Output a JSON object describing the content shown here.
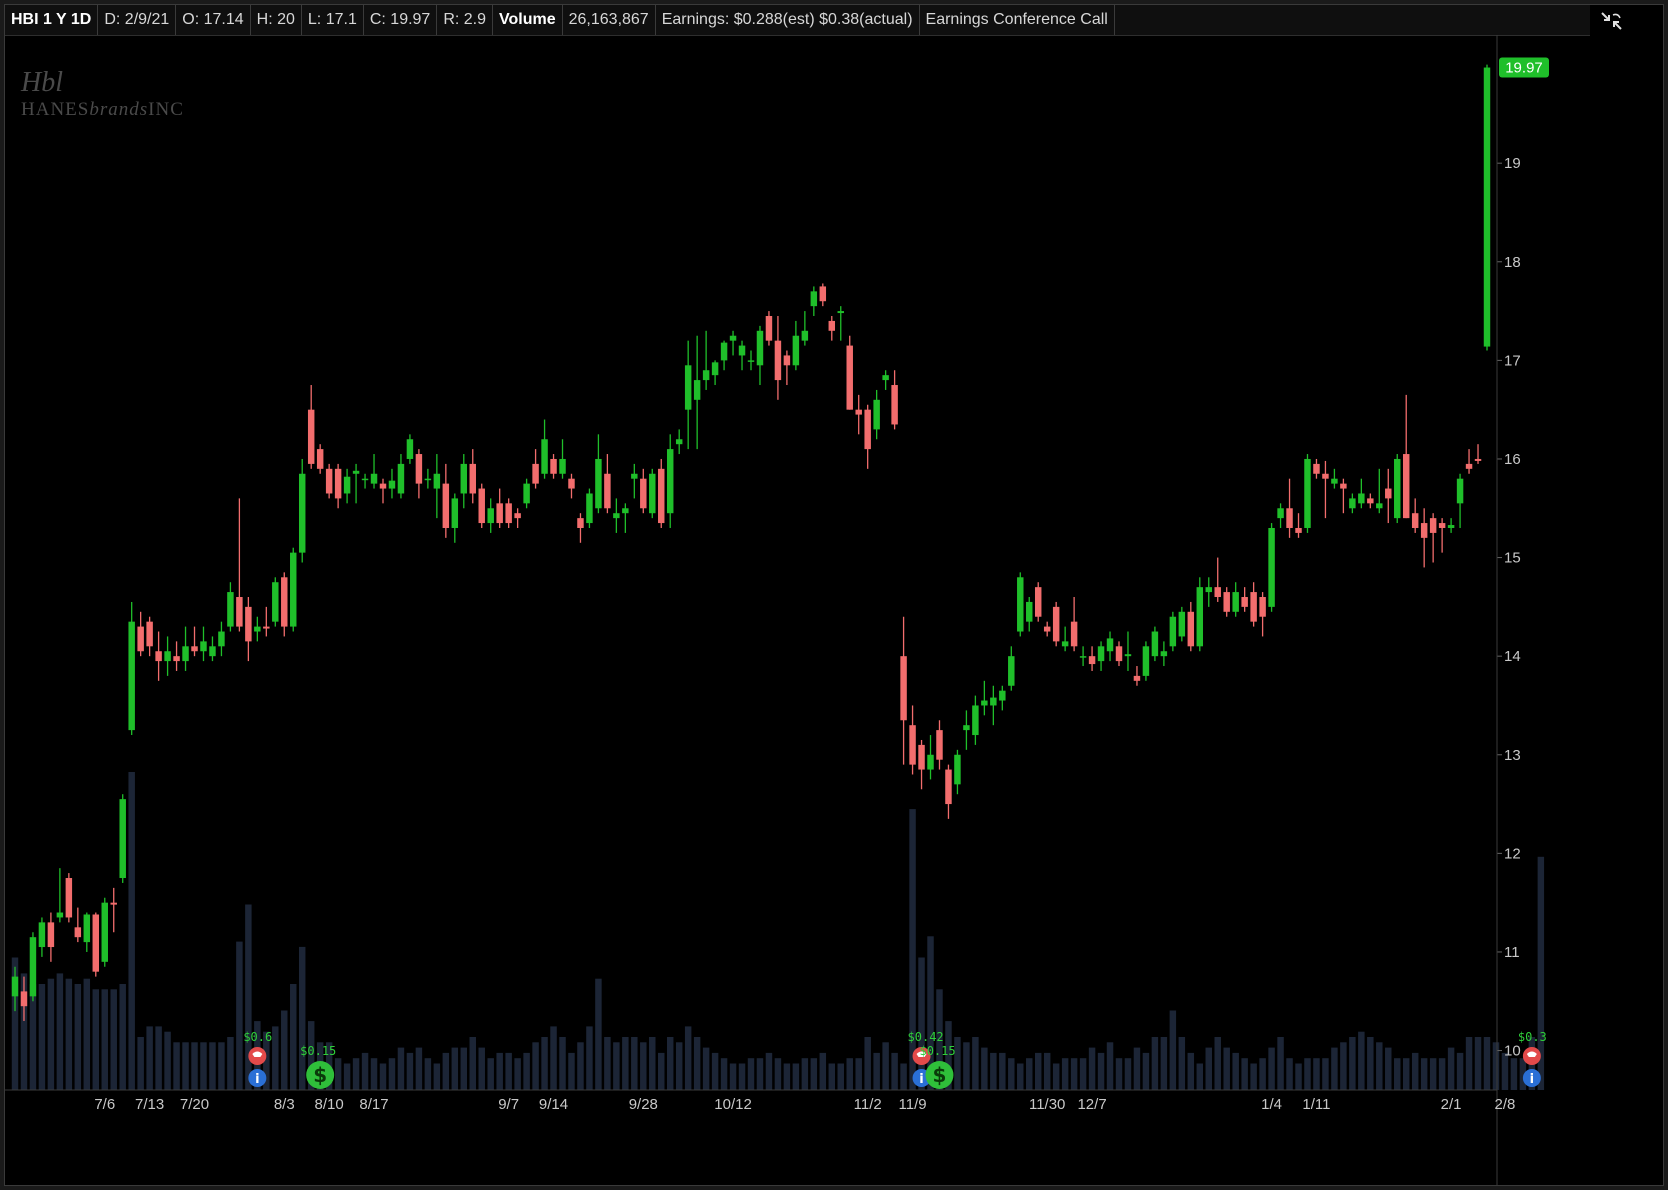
{
  "header": {
    "symbol": "HBI 1 Y 1D",
    "date": "D: 2/9/21",
    "open": "O: 17.14",
    "high": "H: 20",
    "low": "L: 17.1",
    "close": "C: 19.97",
    "range": "R: 2.9",
    "volume_label": "Volume",
    "volume_value": "26,163,867",
    "earnings": "Earnings: $0.288(est) $0.38(actual)",
    "event": "Earnings Conference Call"
  },
  "logo": {
    "mark": "Hbl",
    "wordmark": "HANESbrandsINC"
  },
  "icons": {
    "restore": "collapse-restore-icon",
    "earnings": "earnings-phone-icon",
    "dividend": "dividend-dollar-icon",
    "info": "info-icon"
  },
  "colors": {
    "up": "#1fbf2a",
    "down": "#f26d6d",
    "volume": "#1c2536",
    "background": "#000000",
    "last_price_bg": "#1fbf2a"
  },
  "chart_data": {
    "type": "candlestick",
    "symbol": "HBI",
    "period": "1 Y 1D",
    "ylim": [
      9.6,
      20.3
    ],
    "y_ticks": [
      10,
      11,
      12,
      13,
      14,
      15,
      16,
      17,
      18,
      19
    ],
    "x_ticks": [
      "7/6",
      "7/13",
      "7/20",
      "8/3",
      "8/10",
      "8/17",
      "9/7",
      "9/14",
      "9/28",
      "10/12",
      "11/2",
      "11/9",
      "11/30",
      "12/7",
      "1/4",
      "1/11",
      "2/1",
      "2/8"
    ],
    "last_price": "19.97",
    "candles": [
      {
        "o": 10.55,
        "h": 10.85,
        "l": 10.4,
        "c": 10.75
      },
      {
        "o": 10.6,
        "h": 10.75,
        "l": 10.3,
        "c": 10.45
      },
      {
        "o": 10.55,
        "h": 11.2,
        "l": 10.5,
        "c": 11.15
      },
      {
        "o": 11.05,
        "h": 11.35,
        "l": 10.95,
        "c": 11.3
      },
      {
        "o": 11.3,
        "h": 11.4,
        "l": 10.9,
        "c": 11.05
      },
      {
        "o": 11.35,
        "h": 11.85,
        "l": 11.3,
        "c": 11.4
      },
      {
        "o": 11.75,
        "h": 11.8,
        "l": 11.3,
        "c": 11.35
      },
      {
        "o": 11.25,
        "h": 11.45,
        "l": 11.1,
        "c": 11.15
      },
      {
        "o": 11.1,
        "h": 11.4,
        "l": 11.0,
        "c": 11.38
      },
      {
        "o": 11.38,
        "h": 11.4,
        "l": 10.75,
        "c": 10.8
      },
      {
        "o": 10.9,
        "h": 11.55,
        "l": 10.85,
        "c": 11.5
      },
      {
        "o": 11.5,
        "h": 11.65,
        "l": 11.2,
        "c": 11.48
      },
      {
        "o": 11.75,
        "h": 12.6,
        "l": 11.7,
        "c": 12.55
      },
      {
        "o": 13.25,
        "h": 14.55,
        "l": 13.2,
        "c": 14.35
      },
      {
        "o": 14.3,
        "h": 14.45,
        "l": 14.0,
        "c": 14.05
      },
      {
        "o": 14.35,
        "h": 14.4,
        "l": 14.0,
        "c": 14.1
      },
      {
        "o": 14.05,
        "h": 14.25,
        "l": 13.75,
        "c": 13.95
      },
      {
        "o": 13.95,
        "h": 14.2,
        "l": 13.8,
        "c": 14.05
      },
      {
        "o": 14.0,
        "h": 14.15,
        "l": 13.85,
        "c": 13.95
      },
      {
        "o": 13.95,
        "h": 14.3,
        "l": 13.85,
        "c": 14.1
      },
      {
        "o": 14.1,
        "h": 14.3,
        "l": 14.0,
        "c": 14.05
      },
      {
        "o": 14.05,
        "h": 14.3,
        "l": 13.95,
        "c": 14.15
      },
      {
        "o": 14.0,
        "h": 14.2,
        "l": 13.95,
        "c": 14.1
      },
      {
        "o": 14.1,
        "h": 14.35,
        "l": 14.0,
        "c": 14.25
      },
      {
        "o": 14.3,
        "h": 14.75,
        "l": 14.25,
        "c": 14.65
      },
      {
        "o": 14.6,
        "h": 15.6,
        "l": 14.25,
        "c": 14.3
      },
      {
        "o": 14.5,
        "h": 14.6,
        "l": 13.95,
        "c": 14.15
      },
      {
        "o": 14.25,
        "h": 14.4,
        "l": 14.15,
        "c": 14.3
      },
      {
        "o": 14.3,
        "h": 14.5,
        "l": 14.2,
        "c": 14.28
      },
      {
        "o": 14.35,
        "h": 14.8,
        "l": 14.3,
        "c": 14.75
      },
      {
        "o": 14.8,
        "h": 14.85,
        "l": 14.2,
        "c": 14.3
      },
      {
        "o": 14.3,
        "h": 15.1,
        "l": 14.25,
        "c": 15.05
      },
      {
        "o": 15.05,
        "h": 16.0,
        "l": 14.95,
        "c": 15.85
      },
      {
        "o": 16.5,
        "h": 16.75,
        "l": 15.9,
        "c": 15.95
      },
      {
        "o": 16.1,
        "h": 16.15,
        "l": 15.85,
        "c": 15.9
      },
      {
        "o": 15.9,
        "h": 15.95,
        "l": 15.6,
        "c": 15.65
      },
      {
        "o": 15.9,
        "h": 15.95,
        "l": 15.5,
        "c": 15.6
      },
      {
        "o": 15.65,
        "h": 15.9,
        "l": 15.55,
        "c": 15.82
      },
      {
        "o": 15.85,
        "h": 15.95,
        "l": 15.55,
        "c": 15.88
      },
      {
        "o": 15.8,
        "h": 15.85,
        "l": 15.7,
        "c": 15.8
      },
      {
        "o": 15.75,
        "h": 16.05,
        "l": 15.7,
        "c": 15.85
      },
      {
        "o": 15.75,
        "h": 15.8,
        "l": 15.55,
        "c": 15.7
      },
      {
        "o": 15.7,
        "h": 15.9,
        "l": 15.6,
        "c": 15.78
      },
      {
        "o": 15.65,
        "h": 16.05,
        "l": 15.6,
        "c": 15.95
      },
      {
        "o": 16.0,
        "h": 16.25,
        "l": 15.95,
        "c": 16.2
      },
      {
        "o": 16.05,
        "h": 16.1,
        "l": 15.6,
        "c": 15.75
      },
      {
        "o": 15.8,
        "h": 15.9,
        "l": 15.7,
        "c": 15.8
      },
      {
        "o": 15.7,
        "h": 16.05,
        "l": 15.4,
        "c": 15.85
      },
      {
        "o": 15.75,
        "h": 15.95,
        "l": 15.2,
        "c": 15.3
      },
      {
        "o": 15.3,
        "h": 15.65,
        "l": 15.15,
        "c": 15.6
      },
      {
        "o": 15.65,
        "h": 16.05,
        "l": 15.5,
        "c": 15.95
      },
      {
        "o": 15.95,
        "h": 16.1,
        "l": 15.55,
        "c": 15.65
      },
      {
        "o": 15.7,
        "h": 15.75,
        "l": 15.3,
        "c": 15.35
      },
      {
        "o": 15.35,
        "h": 15.6,
        "l": 15.25,
        "c": 15.5
      },
      {
        "o": 15.55,
        "h": 15.7,
        "l": 15.3,
        "c": 15.35
      },
      {
        "o": 15.55,
        "h": 15.6,
        "l": 15.3,
        "c": 15.35
      },
      {
        "o": 15.45,
        "h": 15.5,
        "l": 15.3,
        "c": 15.4
      },
      {
        "o": 15.55,
        "h": 15.8,
        "l": 15.5,
        "c": 15.75
      },
      {
        "o": 15.95,
        "h": 16.1,
        "l": 15.7,
        "c": 15.75
      },
      {
        "o": 15.85,
        "h": 16.4,
        "l": 15.8,
        "c": 16.2
      },
      {
        "o": 16.0,
        "h": 16.05,
        "l": 15.8,
        "c": 15.85
      },
      {
        "o": 15.85,
        "h": 16.2,
        "l": 15.8,
        "c": 16.0
      },
      {
        "o": 15.8,
        "h": 15.85,
        "l": 15.6,
        "c": 15.7
      },
      {
        "o": 15.4,
        "h": 15.45,
        "l": 15.15,
        "c": 15.3
      },
      {
        "o": 15.35,
        "h": 15.7,
        "l": 15.3,
        "c": 15.65
      },
      {
        "o": 15.5,
        "h": 16.25,
        "l": 15.45,
        "c": 16.0
      },
      {
        "o": 15.85,
        "h": 16.05,
        "l": 15.45,
        "c": 15.5
      },
      {
        "o": 15.4,
        "h": 15.6,
        "l": 15.25,
        "c": 15.45
      },
      {
        "o": 15.45,
        "h": 15.55,
        "l": 15.25,
        "c": 15.5
      },
      {
        "o": 15.8,
        "h": 15.95,
        "l": 15.6,
        "c": 15.85
      },
      {
        "o": 15.8,
        "h": 15.9,
        "l": 15.45,
        "c": 15.5
      },
      {
        "o": 15.45,
        "h": 15.9,
        "l": 15.4,
        "c": 15.85
      },
      {
        "o": 15.9,
        "h": 16.0,
        "l": 15.3,
        "c": 15.35
      },
      {
        "o": 15.45,
        "h": 16.25,
        "l": 15.3,
        "c": 16.1
      },
      {
        "o": 16.15,
        "h": 16.3,
        "l": 16.05,
        "c": 16.2
      },
      {
        "o": 16.5,
        "h": 17.2,
        "l": 16.1,
        "c": 16.95
      },
      {
        "o": 16.6,
        "h": 17.25,
        "l": 16.1,
        "c": 16.8
      },
      {
        "o": 16.8,
        "h": 17.3,
        "l": 16.7,
        "c": 16.9
      },
      {
        "o": 16.85,
        "h": 17.0,
        "l": 16.75,
        "c": 16.98
      },
      {
        "o": 17.0,
        "h": 17.2,
        "l": 16.9,
        "c": 17.18
      },
      {
        "o": 17.2,
        "h": 17.3,
        "l": 17.05,
        "c": 17.25
      },
      {
        "o": 17.05,
        "h": 17.2,
        "l": 16.9,
        "c": 17.15
      },
      {
        "o": 17.0,
        "h": 17.1,
        "l": 16.9,
        "c": 17.0
      },
      {
        "o": 16.95,
        "h": 17.35,
        "l": 16.75,
        "c": 17.3
      },
      {
        "o": 17.45,
        "h": 17.5,
        "l": 17.15,
        "c": 17.2
      },
      {
        "o": 17.2,
        "h": 17.45,
        "l": 16.6,
        "c": 16.8
      },
      {
        "o": 17.05,
        "h": 17.1,
        "l": 16.75,
        "c": 16.95
      },
      {
        "o": 16.95,
        "h": 17.4,
        "l": 16.9,
        "c": 17.25
      },
      {
        "o": 17.2,
        "h": 17.5,
        "l": 17.15,
        "c": 17.3
      },
      {
        "o": 17.55,
        "h": 17.75,
        "l": 17.45,
        "c": 17.7
      },
      {
        "o": 17.75,
        "h": 17.78,
        "l": 17.55,
        "c": 17.6
      },
      {
        "o": 17.4,
        "h": 17.45,
        "l": 17.2,
        "c": 17.3
      },
      {
        "o": 17.48,
        "h": 17.55,
        "l": 17.2,
        "c": 17.5
      },
      {
        "o": 17.15,
        "h": 17.25,
        "l": 16.5,
        "c": 16.5
      },
      {
        "o": 16.5,
        "h": 16.65,
        "l": 16.25,
        "c": 16.45
      },
      {
        "o": 16.5,
        "h": 16.55,
        "l": 15.9,
        "c": 16.1
      },
      {
        "o": 16.3,
        "h": 16.7,
        "l": 16.2,
        "c": 16.6
      },
      {
        "o": 16.8,
        "h": 16.9,
        "l": 16.7,
        "c": 16.85
      },
      {
        "o": 16.75,
        "h": 16.9,
        "l": 16.3,
        "c": 16.35
      },
      {
        "o": 14.0,
        "h": 14.4,
        "l": 12.9,
        "c": 13.35
      },
      {
        "o": 13.3,
        "h": 13.5,
        "l": 12.8,
        "c": 12.9
      },
      {
        "o": 13.1,
        "h": 13.15,
        "l": 12.65,
        "c": 12.85
      },
      {
        "o": 12.85,
        "h": 13.2,
        "l": 12.75,
        "c": 13.0
      },
      {
        "o": 13.25,
        "h": 13.35,
        "l": 12.85,
        "c": 12.95
      },
      {
        "o": 12.85,
        "h": 12.9,
        "l": 12.35,
        "c": 12.5
      },
      {
        "o": 12.7,
        "h": 13.05,
        "l": 12.6,
        "c": 13.0
      },
      {
        "o": 13.25,
        "h": 13.45,
        "l": 13.05,
        "c": 13.3
      },
      {
        "o": 13.2,
        "h": 13.6,
        "l": 13.1,
        "c": 13.5
      },
      {
        "o": 13.5,
        "h": 13.75,
        "l": 13.4,
        "c": 13.55
      },
      {
        "o": 13.5,
        "h": 13.7,
        "l": 13.3,
        "c": 13.58
      },
      {
        "o": 13.55,
        "h": 13.7,
        "l": 13.45,
        "c": 13.65
      },
      {
        "o": 13.7,
        "h": 14.1,
        "l": 13.65,
        "c": 14.0
      },
      {
        "o": 14.25,
        "h": 14.85,
        "l": 14.2,
        "c": 14.8
      },
      {
        "o": 14.35,
        "h": 14.6,
        "l": 14.25,
        "c": 14.55
      },
      {
        "o": 14.7,
        "h": 14.75,
        "l": 14.35,
        "c": 14.4
      },
      {
        "o": 14.3,
        "h": 14.35,
        "l": 14.2,
        "c": 14.25
      },
      {
        "o": 14.5,
        "h": 14.55,
        "l": 14.1,
        "c": 14.15
      },
      {
        "o": 14.1,
        "h": 14.3,
        "l": 14.05,
        "c": 14.15
      },
      {
        "o": 14.35,
        "h": 14.6,
        "l": 14.05,
        "c": 14.1
      },
      {
        "o": 14.0,
        "h": 14.1,
        "l": 13.9,
        "c": 14.0
      },
      {
        "o": 14.0,
        "h": 14.1,
        "l": 13.85,
        "c": 13.92
      },
      {
        "o": 13.95,
        "h": 14.15,
        "l": 13.85,
        "c": 14.1
      },
      {
        "o": 14.05,
        "h": 14.25,
        "l": 13.95,
        "c": 14.18
      },
      {
        "o": 14.1,
        "h": 14.15,
        "l": 13.9,
        "c": 13.95
      },
      {
        "o": 14.0,
        "h": 14.25,
        "l": 13.85,
        "c": 14.02
      },
      {
        "o": 13.8,
        "h": 13.9,
        "l": 13.7,
        "c": 13.75
      },
      {
        "o": 13.8,
        "h": 14.15,
        "l": 13.75,
        "c": 14.1
      },
      {
        "o": 14.0,
        "h": 14.3,
        "l": 13.95,
        "c": 14.25
      },
      {
        "o": 14.0,
        "h": 14.15,
        "l": 13.9,
        "c": 14.05
      },
      {
        "o": 14.1,
        "h": 14.45,
        "l": 14.05,
        "c": 14.4
      },
      {
        "o": 14.2,
        "h": 14.5,
        "l": 14.15,
        "c": 14.45
      },
      {
        "o": 14.45,
        "h": 14.55,
        "l": 14.05,
        "c": 14.1
      },
      {
        "o": 14.1,
        "h": 14.8,
        "l": 14.05,
        "c": 14.7
      },
      {
        "o": 14.65,
        "h": 14.8,
        "l": 14.5,
        "c": 14.7
      },
      {
        "o": 14.7,
        "h": 15.0,
        "l": 14.55,
        "c": 14.6
      },
      {
        "o": 14.65,
        "h": 14.7,
        "l": 14.4,
        "c": 14.45
      },
      {
        "o": 14.45,
        "h": 14.75,
        "l": 14.4,
        "c": 14.65
      },
      {
        "o": 14.6,
        "h": 14.7,
        "l": 14.45,
        "c": 14.5
      },
      {
        "o": 14.65,
        "h": 14.75,
        "l": 14.3,
        "c": 14.35
      },
      {
        "o": 14.6,
        "h": 14.65,
        "l": 14.2,
        "c": 14.4
      },
      {
        "o": 14.5,
        "h": 15.35,
        "l": 14.45,
        "c": 15.3
      },
      {
        "o": 15.4,
        "h": 15.55,
        "l": 15.3,
        "c": 15.5
      },
      {
        "o": 15.5,
        "h": 15.8,
        "l": 15.2,
        "c": 15.3
      },
      {
        "o": 15.3,
        "h": 15.45,
        "l": 15.2,
        "c": 15.25
      },
      {
        "o": 15.3,
        "h": 16.05,
        "l": 15.25,
        "c": 16.0
      },
      {
        "o": 15.95,
        "h": 16.0,
        "l": 15.8,
        "c": 15.85
      },
      {
        "o": 15.85,
        "h": 15.98,
        "l": 15.4,
        "c": 15.8
      },
      {
        "o": 15.75,
        "h": 15.9,
        "l": 15.7,
        "c": 15.8
      },
      {
        "o": 15.75,
        "h": 15.8,
        "l": 15.45,
        "c": 15.7
      },
      {
        "o": 15.5,
        "h": 15.65,
        "l": 15.45,
        "c": 15.6
      },
      {
        "o": 15.55,
        "h": 15.8,
        "l": 15.5,
        "c": 15.65
      },
      {
        "o": 15.6,
        "h": 15.65,
        "l": 15.5,
        "c": 15.55
      },
      {
        "o": 15.5,
        "h": 15.9,
        "l": 15.45,
        "c": 15.55
      },
      {
        "o": 15.7,
        "h": 15.9,
        "l": 15.35,
        "c": 15.6
      },
      {
        "o": 15.4,
        "h": 16.05,
        "l": 15.35,
        "c": 16.0
      },
      {
        "o": 16.05,
        "h": 16.65,
        "l": 15.4,
        "c": 15.4
      },
      {
        "o": 15.45,
        "h": 15.6,
        "l": 15.25,
        "c": 15.3
      },
      {
        "o": 15.35,
        "h": 15.5,
        "l": 14.9,
        "c": 15.2
      },
      {
        "o": 15.4,
        "h": 15.45,
        "l": 14.95,
        "c": 15.25
      },
      {
        "o": 15.35,
        "h": 15.4,
        "l": 15.05,
        "c": 15.3
      },
      {
        "o": 15.3,
        "h": 15.4,
        "l": 15.25,
        "c": 15.33
      },
      {
        "o": 15.55,
        "h": 15.85,
        "l": 15.3,
        "c": 15.8
      },
      {
        "o": 15.95,
        "h": 16.1,
        "l": 15.85,
        "c": 15.9
      },
      {
        "o": 16.0,
        "h": 16.15,
        "l": 15.95,
        "c": 15.98
      },
      {
        "o": 17.14,
        "h": 20.0,
        "l": 17.1,
        "c": 19.97
      }
    ],
    "volume": [
      0.25,
      0.22,
      0.2,
      0.2,
      0.21,
      0.22,
      0.21,
      0.2,
      0.21,
      0.19,
      0.19,
      0.19,
      0.2,
      0.6,
      0.1,
      0.12,
      0.12,
      0.11,
      0.09,
      0.09,
      0.09,
      0.09,
      0.09,
      0.09,
      0.1,
      0.28,
      0.35,
      0.13,
      0.11,
      0.12,
      0.15,
      0.2,
      0.27,
      0.13,
      0.09,
      0.09,
      0.06,
      0.05,
      0.06,
      0.07,
      0.06,
      0.05,
      0.06,
      0.08,
      0.07,
      0.08,
      0.06,
      0.05,
      0.07,
      0.08,
      0.08,
      0.1,
      0.08,
      0.06,
      0.07,
      0.07,
      0.06,
      0.07,
      0.09,
      0.1,
      0.12,
      0.1,
      0.07,
      0.09,
      0.12,
      0.21,
      0.1,
      0.09,
      0.1,
      0.1,
      0.09,
      0.1,
      0.07,
      0.1,
      0.09,
      0.12,
      0.1,
      0.08,
      0.07,
      0.06,
      0.05,
      0.05,
      0.06,
      0.06,
      0.07,
      0.06,
      0.05,
      0.05,
      0.06,
      0.06,
      0.07,
      0.05,
      0.05,
      0.06,
      0.06,
      0.1,
      0.07,
      0.09,
      0.07,
      0.05,
      0.53,
      0.25,
      0.29,
      0.19,
      0.13,
      0.1,
      0.09,
      0.1,
      0.08,
      0.07,
      0.07,
      0.06,
      0.05,
      0.06,
      0.07,
      0.07,
      0.05,
      0.06,
      0.06,
      0.06,
      0.08,
      0.07,
      0.09,
      0.06,
      0.06,
      0.08,
      0.07,
      0.1,
      0.1,
      0.15,
      0.1,
      0.07,
      0.05,
      0.08,
      0.1,
      0.08,
      0.07,
      0.06,
      0.05,
      0.06,
      0.08,
      0.1,
      0.06,
      0.05,
      0.06,
      0.06,
      0.06,
      0.08,
      0.09,
      0.1,
      0.11,
      0.1,
      0.09,
      0.08,
      0.06,
      0.06,
      0.07,
      0.06,
      0.06,
      0.06,
      0.08,
      0.07,
      0.1,
      0.1,
      0.1,
      0.09,
      0.07,
      0.06,
      0.06,
      0.1,
      0.44
    ],
    "events": [
      {
        "label": "$0.6",
        "type": "earnings",
        "index": 27
      },
      {
        "label": "$0.15",
        "type": "dividend",
        "index": 34
      },
      {
        "label": "$0.42",
        "type": "earnings",
        "index": 101
      },
      {
        "label": "$0.15",
        "type": "dividend",
        "index": 103
      },
      {
        "label": "$0.3",
        "type": "earnings",
        "index": 169
      }
    ]
  }
}
